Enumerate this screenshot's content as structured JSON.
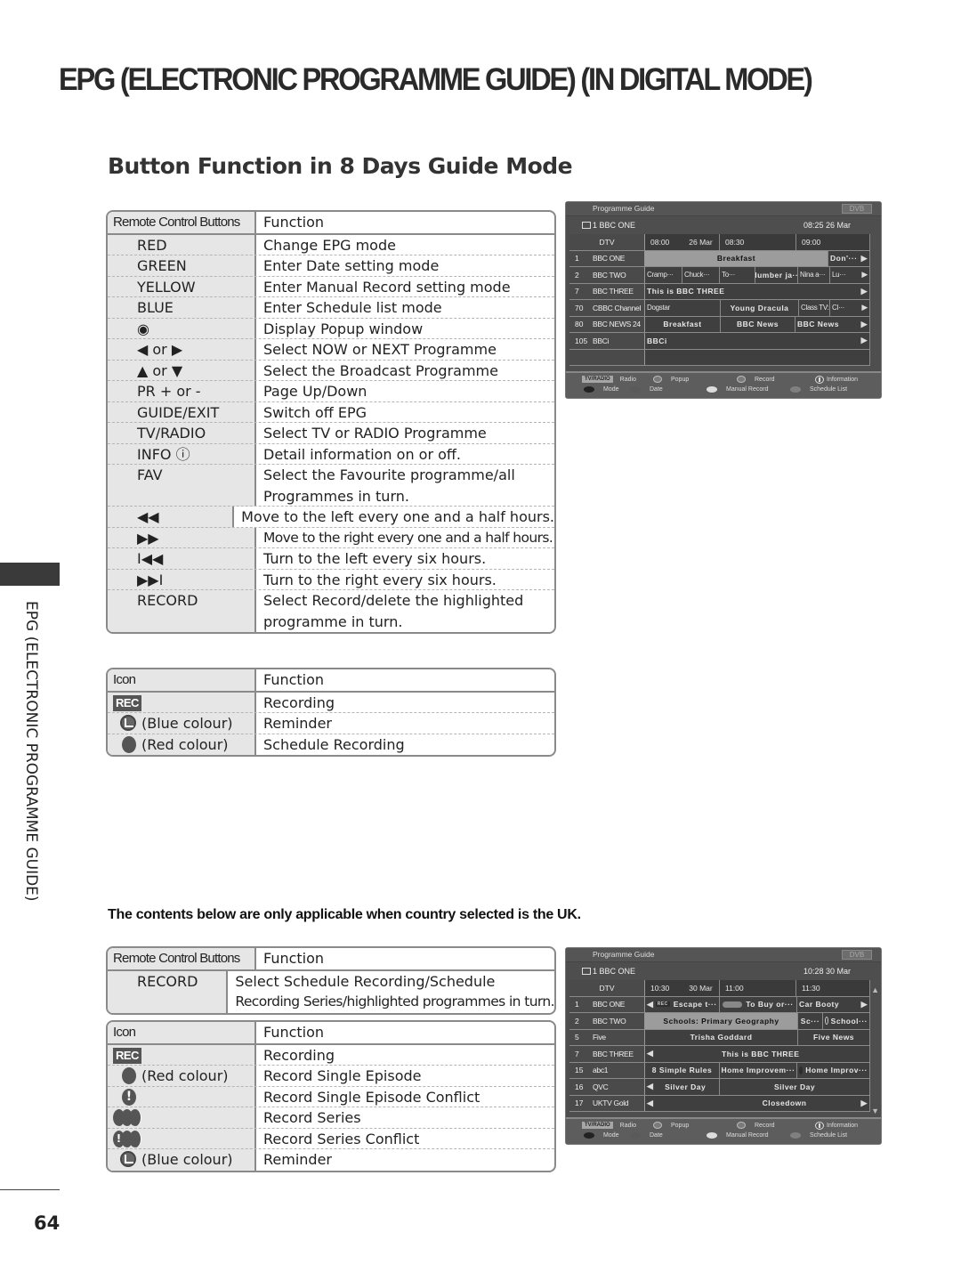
{
  "page": {
    "title": "EPG (ELECTRONIC PROGRAMME GUIDE) (IN DIGITAL MODE)",
    "subtitle": "Button Function in 8 Days Guide Mode",
    "side_tab": "EPG (ELECTRONIC PROGRAMME GUIDE)",
    "page_number": "64",
    "uk_note": "The contents below are only applicable when country selected is the UK."
  },
  "buttons_table": {
    "col1": "Remote Control Buttons",
    "col2": "Function",
    "rows": [
      {
        "button": "RED",
        "function": "Change EPG mode"
      },
      {
        "button": "GREEN",
        "function": "Enter Date setting mode"
      },
      {
        "button": "YELLOW",
        "function": "Enter Manual Record setting mode"
      },
      {
        "button": "BLUE",
        "function": "Enter Schedule list mode"
      },
      {
        "button": "◉",
        "function": "Display Popup window"
      },
      {
        "button": "◀ or ▶",
        "function": "Select NOW or NEXT Programme"
      },
      {
        "button": "▲ or ▼",
        "function": "Select the Broadcast Programme"
      },
      {
        "button": "PR + or -",
        "function": "Page Up/Down"
      },
      {
        "button": "GUIDE/EXIT",
        "function": "Switch off EPG"
      },
      {
        "button": "TV/RADIO",
        "function": "Select TV or RADIO Programme"
      },
      {
        "button": "INFO ⓘ",
        "function": "Detail information on or off."
      },
      {
        "button": "FAV",
        "function": "Select the Favourite programme/all",
        "function2": "Programmes in turn."
      },
      {
        "button": "◀◀",
        "function": "Move to the left every one and a half hours."
      },
      {
        "button": "▶▶",
        "function": "Move to the right every one and a half hours."
      },
      {
        "button": "I◀◀",
        "function": "Turn to the left every six hours."
      },
      {
        "button": "▶▶I",
        "function": "Turn to the right every six hours."
      },
      {
        "button": "RECORD",
        "function": "Select Record/delete the highlighted",
        "function2": "programme in turn."
      }
    ]
  },
  "icons_table": {
    "col1": "Icon",
    "col2": "Function",
    "rows": [
      {
        "icon": "rec-badge",
        "icon_text": "REC",
        "label": "",
        "function": "Recording"
      },
      {
        "icon": "reminder-clock",
        "label": "(Blue colour)",
        "function": "Reminder"
      },
      {
        "icon": "record-dot",
        "label": "(Red colour)",
        "function": "Schedule Recording"
      }
    ]
  },
  "uk_buttons_table": {
    "col1": "Remote Control Buttons",
    "col2": "Function",
    "rows": [
      {
        "button": "RECORD",
        "function": "Select Schedule Recording/Schedule",
        "function2": "Recording Series/highlighted programmes in turn."
      }
    ]
  },
  "uk_icons_table": {
    "col1": "Icon",
    "col2": "Function",
    "rows": [
      {
        "icon": "rec-badge",
        "icon_text": "REC",
        "label": "",
        "function": "Recording"
      },
      {
        "icon": "record-dot",
        "label": "(Red colour)",
        "function": "Record Single Episode"
      },
      {
        "icon": "record-conflict",
        "label": "",
        "function": "Record Single Episode Conflict"
      },
      {
        "icon": "record-series",
        "label": "",
        "function": "Record Series"
      },
      {
        "icon": "record-series-conflict",
        "label": "",
        "function": "Record Series Conflict"
      },
      {
        "icon": "reminder-clock",
        "label": "(Blue colour)",
        "function": "Reminder"
      }
    ]
  },
  "epg_screen_1": {
    "title": "Programme Guide",
    "badge": "DVB",
    "channel": "1  BBC  ONE",
    "clock": "08:25 26 Mar",
    "header": {
      "source": "DTV",
      "t1": "08:00",
      "date": "26 Mar",
      "t2": "08:30",
      "t3": "09:00"
    },
    "rows": [
      {
        "num": "1",
        "name": "BBC ONE",
        "progs": [
          {
            "t": "Breakfast",
            "hl": true
          },
          {
            "t": "Don'···",
            "arrow": true
          }
        ]
      },
      {
        "num": "2",
        "name": "BBC TWO",
        "progs": [
          {
            "t": "Cramp···"
          },
          {
            "t": "Chuck···"
          },
          {
            "t": "To···"
          },
          {
            "t": "Number ja···"
          },
          {
            "t": "Nina a···"
          },
          {
            "t": "Lu···",
            "arrow": true
          }
        ]
      },
      {
        "num": "7",
        "name": "BBC THREE",
        "progs": [
          {
            "t": "This is BBC THREE",
            "arrow": true
          }
        ]
      },
      {
        "num": "70",
        "name": "CBBC Channel",
        "progs": [
          {
            "t": "Dogstar"
          },
          {
            "t": "Young Dracula"
          },
          {
            "t": "Class TV:-"
          },
          {
            "t": "Cl···",
            "arrow": true
          }
        ]
      },
      {
        "num": "80",
        "name": "BBC NEWS 24",
        "progs": [
          {
            "t": "Breakfast"
          },
          {
            "t": "BBC News"
          },
          {
            "t": "BBC News",
            "arrow": true
          }
        ]
      },
      {
        "num": "105",
        "name": "BBCi",
        "progs": [
          {
            "t": "BBCi",
            "arrow": true
          }
        ]
      },
      {
        "num": "",
        "name": "",
        "progs": [
          {
            "t": ""
          }
        ]
      }
    ],
    "legend": {
      "tvradio": "TV/RADIO",
      "radio": "Radio",
      "popup": "Popup",
      "record": "Record",
      "information": "Information",
      "mode": "Mode",
      "date": "Date",
      "manual_record": "Manual Record",
      "schedule_list": "Schedule List"
    }
  },
  "epg_screen_2": {
    "title": "Programme Guide",
    "badge": "DVB",
    "channel": "1  BBC  ONE",
    "clock": "10:28 30 Mar",
    "header": {
      "source": "DTV",
      "t1": "10:30",
      "date": "30 Mar",
      "t2": "11:00",
      "t3": "11:30"
    },
    "rows": [
      {
        "num": "1",
        "name": "BBC ONE",
        "progs": [
          {
            "t": "Escape t···",
            "rec": "REC",
            "left": true
          },
          {
            "t": "To Buy or···",
            "series": true
          },
          {
            "t": "Car Booty",
            "arrow": true
          }
        ]
      },
      {
        "num": "2",
        "name": "BBC TWO",
        "progs": [
          {
            "t": "Schools: Primary Geography",
            "hl": true
          },
          {
            "t": "Sc···"
          },
          {
            "t": "School···",
            "clock": true
          }
        ]
      },
      {
        "num": "5",
        "name": "Five",
        "progs": [
          {
            "t": "Trisha Goddard"
          },
          {
            "t": "Five News"
          }
        ]
      },
      {
        "num": "7",
        "name": "BBC THREE",
        "progs": [
          {
            "t": "This is BBC THREE",
            "left": true
          }
        ]
      },
      {
        "num": "15",
        "name": "abc1",
        "progs": [
          {
            "t": "8 Simple Rules"
          },
          {
            "t": "Home Improvem···"
          },
          {
            "t": "Home Improv···",
            "dot": true
          }
        ]
      },
      {
        "num": "16",
        "name": "QVC",
        "progs": [
          {
            "t": "Silver Day",
            "left": true
          },
          {
            "t": "Silver Day"
          }
        ]
      },
      {
        "num": "17",
        "name": "UKTV Gold",
        "progs": [
          {
            "t": "Closedown",
            "left": true,
            "arrow": true
          }
        ]
      }
    ],
    "legend": {
      "tvradio": "TV/RADIO",
      "radio": "Radio",
      "popup": "Popup",
      "record": "Record",
      "information": "Information",
      "mode": "Mode",
      "date": "Date",
      "manual_record": "Manual Record",
      "schedule_list": "Schedule List"
    }
  }
}
